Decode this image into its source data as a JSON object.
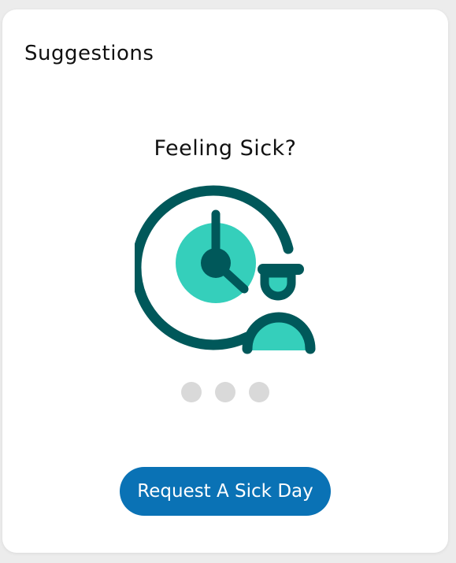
{
  "card": {
    "title": "Suggestions"
  },
  "slide": {
    "title": "Feeling Sick?",
    "illustration_icon": "clock-person-icon",
    "button_label": "Request A Sick Day"
  },
  "carousel": {
    "dot_count": 3
  },
  "colors": {
    "dark_teal": "#00585a",
    "light_teal": "#35cfbb",
    "button_blue": "#0a72b5",
    "dot_gray": "#d9d9d9"
  }
}
